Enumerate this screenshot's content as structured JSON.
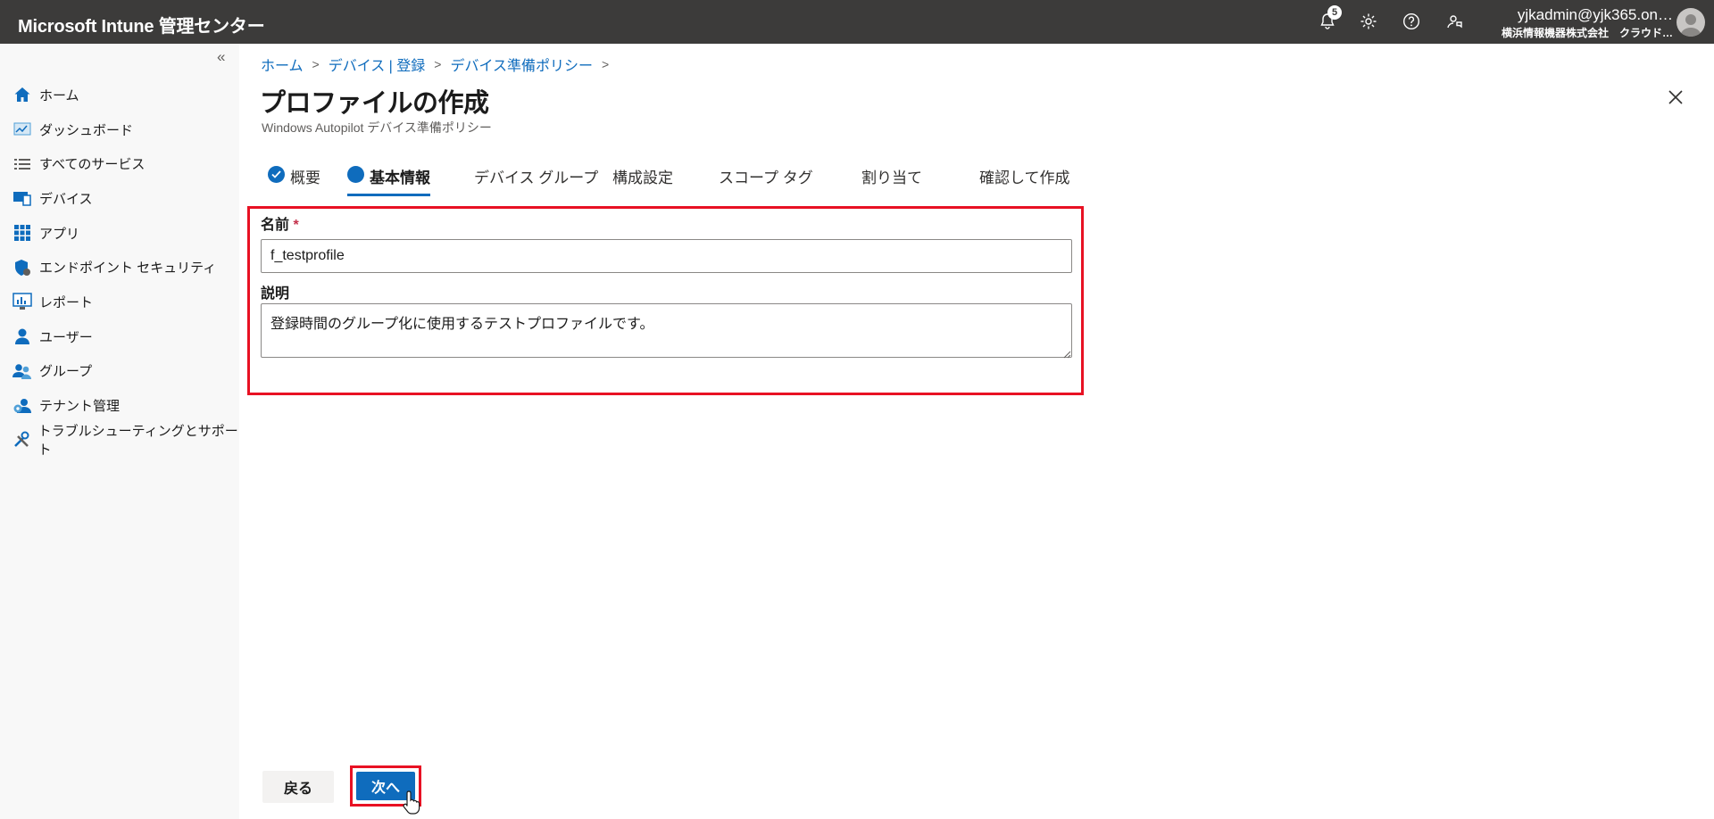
{
  "app": {
    "title": "Microsoft Intune 管理センター"
  },
  "topbar": {
    "notification_count": "5",
    "icons": [
      "bell-icon",
      "gear-icon",
      "help-icon",
      "feedback-icon"
    ],
    "account_email": "yjkadmin@yjk365.on…",
    "account_tenant": "横浜情報機器株式会社　クラウド…"
  },
  "sidebar": {
    "collapse_label": "«",
    "items": [
      {
        "label": "ホーム",
        "icon": "home-icon"
      },
      {
        "label": "ダッシュボード",
        "icon": "dashboard-icon"
      },
      {
        "label": "すべてのサービス",
        "icon": "list-icon"
      },
      {
        "label": "デバイス",
        "icon": "devices-icon"
      },
      {
        "label": "アプリ",
        "icon": "apps-grid-icon"
      },
      {
        "label": "エンドポイント セキュリティ",
        "icon": "shield-icon"
      },
      {
        "label": "レポート",
        "icon": "report-icon"
      },
      {
        "label": "ユーザー",
        "icon": "user-icon"
      },
      {
        "label": "グループ",
        "icon": "group-icon"
      },
      {
        "label": "テナント管理",
        "icon": "tenant-admin-icon"
      },
      {
        "label": "トラブルシューティングとサポート",
        "icon": "tools-icon"
      }
    ]
  },
  "breadcrumb": [
    "ホーム",
    "デバイス | 登録",
    "デバイス準備ポリシー"
  ],
  "page": {
    "title": "プロファイルの作成",
    "more": "…",
    "subtitle": "Windows Autopilot デバイス準備ポリシー"
  },
  "tabs": [
    {
      "label": "概要",
      "state": "completed"
    },
    {
      "label": "基本情報",
      "state": "active"
    },
    {
      "label": "デバイス グループ",
      "state": "pending"
    },
    {
      "label": "構成設定",
      "state": "pending"
    },
    {
      "label": "スコープ タグ",
      "state": "pending"
    },
    {
      "label": "割り当て",
      "state": "pending"
    },
    {
      "label": "確認して作成",
      "state": "pending"
    }
  ],
  "form": {
    "name_label": "名前",
    "required_mark": "*",
    "name_value": "f_testprofile",
    "description_label": "説明",
    "description_value": "登録時間のグループ化に使用するテストプロファイルです。"
  },
  "footer": {
    "back_label": "戻る",
    "next_label": "次へ"
  },
  "colors": {
    "topbar": "#3c3b3a",
    "accent": "#0f6cbd",
    "highlight": "#e81123",
    "sidebar_bg": "#f8f8f8"
  }
}
